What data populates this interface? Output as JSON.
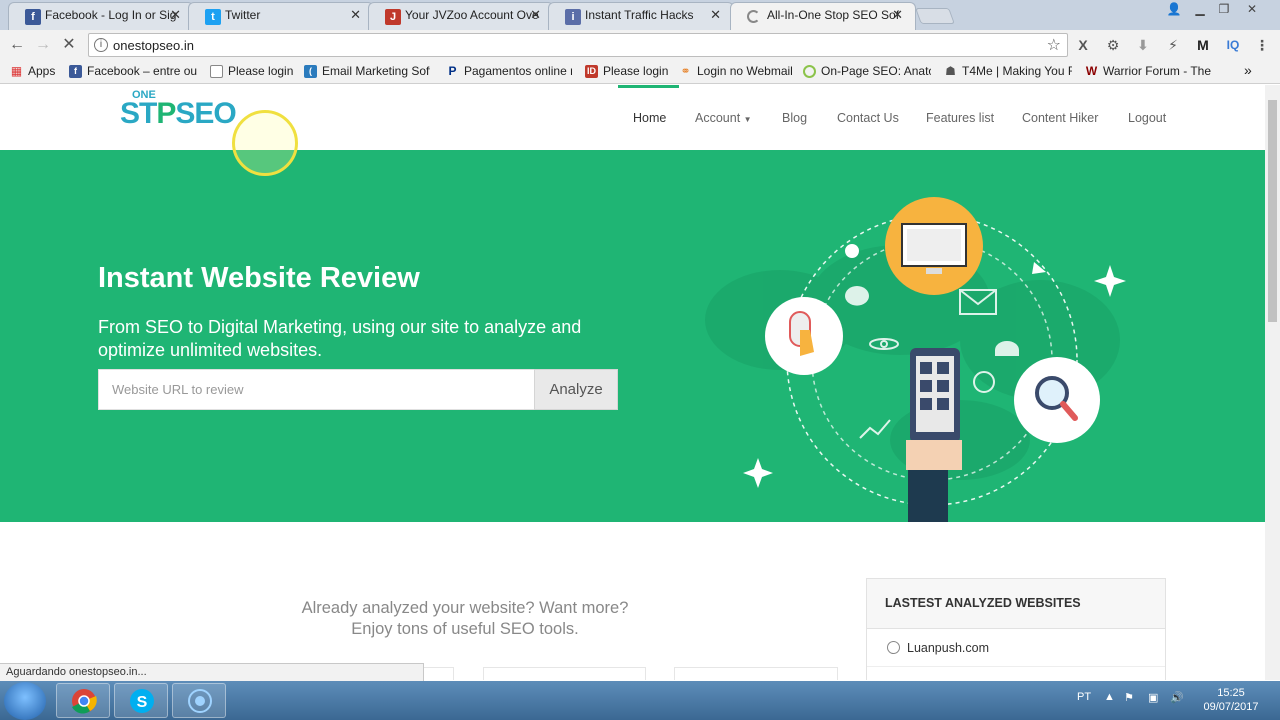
{
  "browser": {
    "tabs": [
      {
        "title": "Facebook - Log In or Sig",
        "favicon": "facebook-icon",
        "color": "#3b5998",
        "active": false
      },
      {
        "title": "Twitter",
        "favicon": "twitter-icon",
        "color": "#1da1f2",
        "active": false
      },
      {
        "title": "Your JVZoo Account Ove",
        "favicon": "jvzoo-icon",
        "color": "#c0392b",
        "active": false
      },
      {
        "title": "Instant Traffic Hacks",
        "favicon": "site-icon",
        "color": "#5b6ea8",
        "active": false
      },
      {
        "title": "All-In-One Stop SEO Sof",
        "favicon": "loading-icon",
        "color": "#888888",
        "active": true
      }
    ],
    "url": "onestopseo.in",
    "bookmarks": [
      {
        "label": "Apps",
        "icon": "apps-grid-icon"
      },
      {
        "label": "Facebook – entre ou",
        "icon": "facebook-icon"
      },
      {
        "label": "Please login",
        "icon": "page-icon"
      },
      {
        "label": "Email Marketing Soft",
        "icon": "email-icon"
      },
      {
        "label": "Pagamentos online n",
        "icon": "paypal-icon"
      },
      {
        "label": "Please login",
        "icon": "id-icon"
      },
      {
        "label": "Login no Webmail",
        "icon": "webmail-icon"
      },
      {
        "label": "On-Page SEO: Anato",
        "icon": "circle-icon"
      },
      {
        "label": "T4Me | Making You F",
        "icon": "t4me-icon"
      },
      {
        "label": "Warrior Forum - The",
        "icon": "warrior-icon"
      }
    ],
    "more_bookmarks": "»",
    "status": "Aguardando onestopseo.in..."
  },
  "site": {
    "logo": {
      "one": "ONE",
      "part1": "ST",
      "part2": "P",
      "part3": "SEO"
    },
    "nav": [
      "Home",
      "Account",
      "Blog",
      "Contact Us",
      "Features list",
      "Content Hiker",
      "Logout"
    ],
    "hero": {
      "title": "Instant Website Review",
      "subtitle": "From SEO to Digital Marketing, using our site to analyze and optimize unlimited websites.",
      "placeholder": "Website URL to review",
      "button": "Analyze"
    },
    "promo_line1": "Already analyzed your website? Want more?",
    "promo_line2": "Enjoy tons of useful SEO tools.",
    "panel": {
      "title": "LASTEST ANALYZED WEBSITES",
      "items": [
        "Luanpush.com"
      ]
    },
    "colors": {
      "accent": "#1fb574",
      "logo_blue": "#2aa8c4"
    }
  },
  "taskbar": {
    "language": "PT",
    "time": "15:25",
    "date": "09/07/2017"
  }
}
